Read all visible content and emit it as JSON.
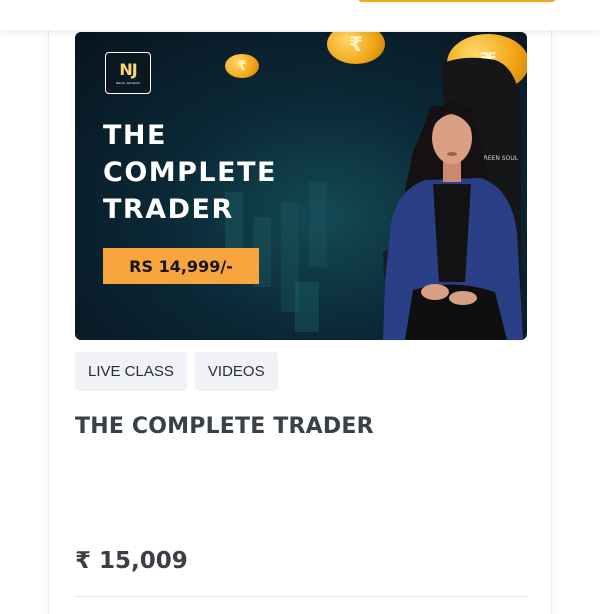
{
  "card": {
    "banner": {
      "logo_mark": "NJ",
      "logo_text": "NEHA JANGRA",
      "title": "THE\nCOMPLETE\nTRADER",
      "price": "RS 14,999/-",
      "coin_symbol": "₹",
      "chair_label": "GREEN SOUL",
      "colors": {
        "background": "#0b2836",
        "badge": "#f7a53c",
        "coin": "#f2a516",
        "jacket": "#2b3f86"
      }
    },
    "tags": [
      "LIVE CLASS",
      "VIDEOS"
    ],
    "title": "THE COMPLETE TRADER",
    "price": "₹ 15,009"
  }
}
